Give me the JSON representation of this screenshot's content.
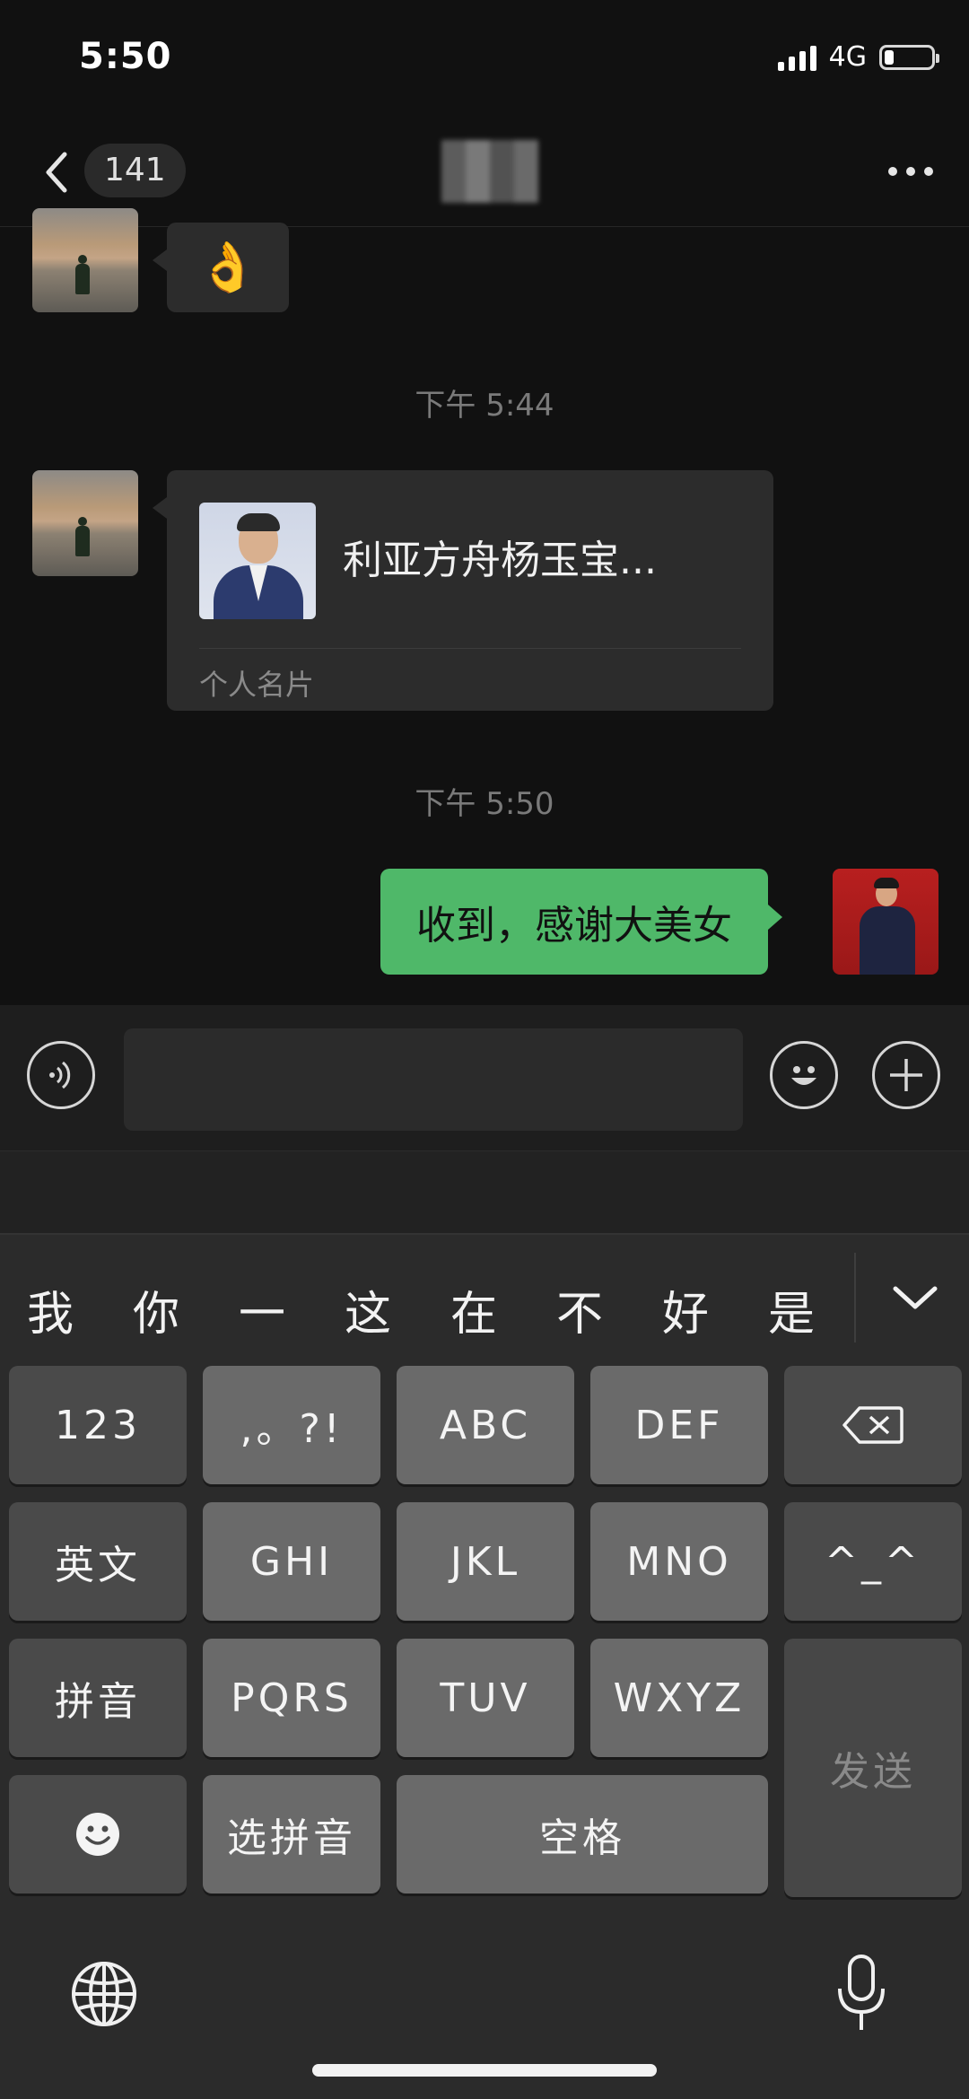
{
  "status_bar": {
    "time": "5:50",
    "network": "4G",
    "battery_level": 0.2
  },
  "navbar": {
    "unread_count": "141",
    "title_obscured": true
  },
  "messages": {
    "first_emoji": "👌",
    "time_1": "下午 5:44",
    "card": {
      "name": "利亚方舟杨玉宝...",
      "label": "个人名片"
    },
    "time_2": "下午 5:50",
    "sent_text": "收到，感谢大美女"
  },
  "input": {
    "value": "",
    "placeholder": ""
  },
  "keyboard": {
    "candidates": [
      "我",
      "你",
      "一",
      "这",
      "在",
      "不",
      "好",
      "是"
    ],
    "keys": {
      "num": "123",
      "punct": ",。?!",
      "abc": "ABC",
      "def": "DEF",
      "english": "英文",
      "ghi": "GHI",
      "jkl": "JKL",
      "mno": "MNO",
      "kaomoji": "^_^",
      "pinyin": "拼音",
      "pqrs": "PQRS",
      "tuv": "TUV",
      "wxyz": "WXYZ",
      "select_pinyin": "选拼音",
      "space": "空格",
      "send": "发送"
    }
  },
  "colors": {
    "sent_bubble": "#4fb869",
    "received_bubble": "#2c2c2c",
    "background": "#111111"
  }
}
